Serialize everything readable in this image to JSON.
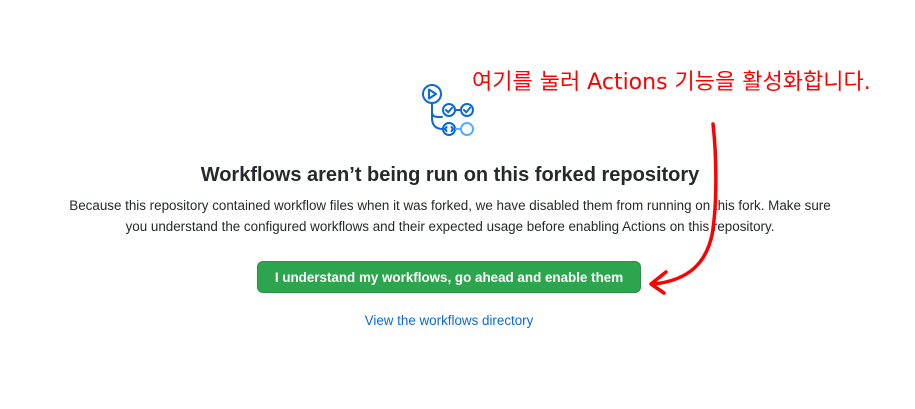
{
  "blankslate": {
    "title": "Workflows aren’t being run on this forked repository",
    "description_line1": "Because this repository contained workflow files when it was forked, we have disabled them from running on this fork. Make sure",
    "description_line2": "you understand the configured workflows and their expected usage before enabling Actions on this repository.",
    "enable_button_label": "I understand my workflows, go ahead and enable them",
    "workflows_link_label": "View the workflows directory"
  },
  "annotation": {
    "text": "여기를 눌러 Actions 기능을 활성화합니다."
  },
  "colors": {
    "primary_button": "#2da44e",
    "link": "#0969da",
    "icon_blue": "#0969da",
    "annotation_red": "#ff0000"
  },
  "icons": {
    "workflow_graph": "workflow-graph-icon"
  }
}
